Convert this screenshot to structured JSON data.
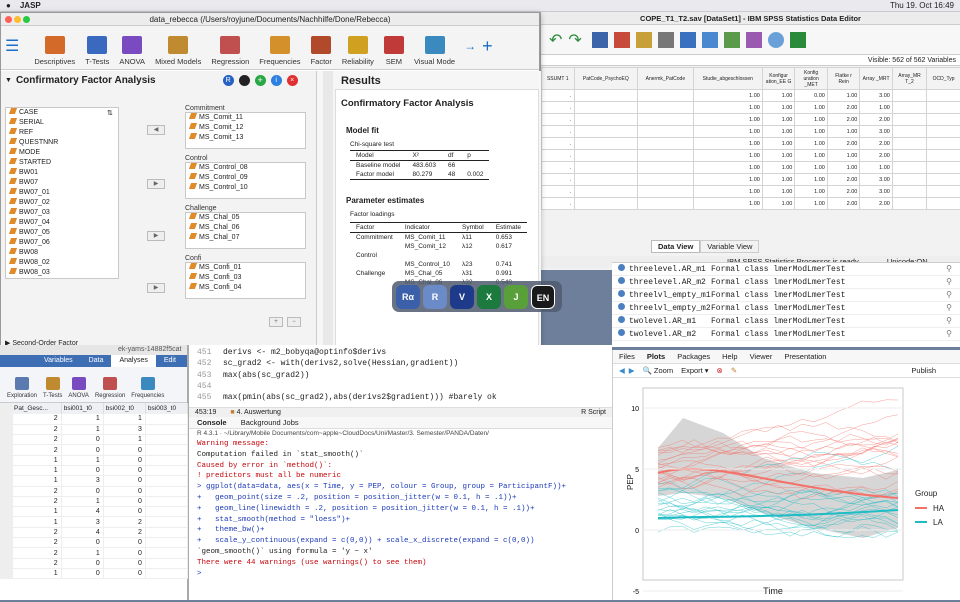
{
  "menubar": {
    "app": "JASP",
    "time": "Thu 19. Oct  16:49"
  },
  "jasp": {
    "title": "data_rebecca     (/Users/royjune/Documents/Nachhilfe/Done/Rebecca)",
    "ribbon": [
      "Descriptives",
      "T-Tests",
      "ANOVA",
      "Mixed Models",
      "Regression",
      "Frequencies",
      "Factor",
      "Reliability",
      "SEM",
      "Visual Mode"
    ],
    "analysis_title": "Confirmatory Factor Analysis",
    "variables": [
      "CASE",
      "SERIAL",
      "REF",
      "QUESTNNR",
      "MODE",
      "STARTED",
      "BW01",
      "BW07",
      "BW07_01",
      "BW07_02",
      "BW07_03",
      "BW07_04",
      "BW07_05",
      "BW07_06",
      "BW08",
      "BW08_02",
      "BW08_03"
    ],
    "factors": [
      {
        "name": "Commitment",
        "items": [
          "MS_Comit_11",
          "MS_Comit_12",
          "MS_Comit_13"
        ]
      },
      {
        "name": "Control",
        "items": [
          "MS_Control_08",
          "MS_Control_09",
          "MS_Control_10"
        ]
      },
      {
        "name": "Challenge",
        "items": [
          "MS_Chal_05",
          "MS_Chal_06",
          "MS_Chal_07"
        ]
      },
      {
        "name": "Confi",
        "items": [
          "MS_Confi_01",
          "MS_Confi_03",
          "MS_Confi_04"
        ]
      }
    ],
    "second_order": "Second-Order Factor",
    "results": {
      "heading": "Results",
      "cfa": "Confirmatory Factor Analysis",
      "model_fit": "Model fit",
      "chi_square": "Chi-square test",
      "fit_cols": [
        "Model",
        "X²",
        "df",
        "p"
      ],
      "fit_rows": [
        [
          "Baseline model",
          "483.603",
          "66",
          ""
        ],
        [
          "Factor model",
          "80.279",
          "48",
          "0.002"
        ]
      ],
      "param": "Parameter estimates",
      "loadings": "Factor loadings",
      "load_cols": [
        "Factor",
        "Indicator",
        "Symbol",
        "Estimate"
      ],
      "load_rows": [
        [
          "Commitment",
          "MS_Comit_11",
          "λ11",
          "0.653"
        ],
        [
          "",
          "MS_Comit_12",
          "λ12",
          "0.617"
        ],
        [
          "Control",
          "",
          "",
          ""
        ],
        [
          "",
          "MS_Control_10",
          "λ23",
          "0.741"
        ],
        [
          "Challenge",
          "MS_Chal_05",
          "λ31",
          "0.991"
        ],
        [
          "",
          "MS_Chal_06",
          "λ32",
          "0.540"
        ]
      ]
    }
  },
  "spss": {
    "title": "COPE_T1_T2.sav [DataSet1] - IBM SPSS Statistics Data Editor",
    "visible": "Visible: 562 of 562 Variables",
    "cols": [
      "SSUMT 1",
      "PatCode_PsychoEQ",
      "Anermk_PatCode",
      "Studie_abgeschlossen",
      "Konfigur ation_EE G",
      "Konfig uration _MET",
      "Flatke r Rein",
      "Array _MRT",
      "Array_MR T_2",
      "OCD_Typ"
    ],
    "rows": [
      [
        ".",
        "",
        "",
        "1.00",
        "1.00",
        "0.00",
        "1.00",
        "3.00",
        "",
        ""
      ],
      [
        ".",
        "",
        "",
        "1.00",
        "1.00",
        "1.00",
        "2.00",
        "1.00",
        "",
        ""
      ],
      [
        ".",
        "",
        "",
        "1.00",
        "1.00",
        "1.00",
        "2.00",
        "2.00",
        "",
        ""
      ],
      [
        ".",
        "",
        "",
        "1.00",
        "1.00",
        "1.00",
        "1.00",
        "3.00",
        "",
        ""
      ],
      [
        ".",
        "",
        "",
        "1.00",
        "1.00",
        "1.00",
        "2.00",
        "2.00",
        "",
        ""
      ],
      [
        ".",
        "",
        "",
        "1.00",
        "1.00",
        "1.00",
        "1.00",
        "2.00",
        "",
        ""
      ],
      [
        ".",
        "",
        "",
        "1.00",
        "1.00",
        "1.00",
        "1.00",
        "1.00",
        "",
        ""
      ],
      [
        ".",
        "",
        "",
        "1.00",
        "1.00",
        "1.00",
        "2.00",
        "3.00",
        "",
        ""
      ],
      [
        ".",
        "",
        "",
        "1.00",
        "1.00",
        "1.00",
        "2.00",
        "3.00",
        "",
        ""
      ],
      [
        ".",
        "",
        "",
        "1.00",
        "1.00",
        "1.00",
        "2.00",
        "2.00",
        "",
        ""
      ]
    ],
    "tabs": [
      "Data View",
      "Variable View"
    ],
    "status": "IBM SPSS Statistics Processor is ready",
    "unicode": "Unicode:ON"
  },
  "env": [
    [
      "threelevel.AR_m1",
      "Formal class  lmerModLmerTest"
    ],
    [
      "threelevel.AR_m2",
      "Formal class  lmerModLmerTest"
    ],
    [
      "threelvl_empty_m1",
      "Formal class  lmerModLmerTest"
    ],
    [
      "threelvl_empty_m2",
      "Formal class  lmerModLmerTest"
    ],
    [
      "twolevel.AR_m1",
      "Formal class  lmerModLmerTest"
    ],
    [
      "twolevel.AR_m2",
      "Formal class  lmerModLmerTest"
    ]
  ],
  "plots": {
    "tabs": [
      "Files",
      "Plots",
      "Packages",
      "Help",
      "Viewer",
      "Presentation"
    ],
    "zoom": "Zoom",
    "export": "Export",
    "publish": "Publish",
    "legend_title": "Group",
    "legend": [
      "HA",
      "LA"
    ],
    "ylabel": "PEP",
    "xlabel": "Time",
    "yticks": [
      "10",
      "5",
      "0",
      "-5"
    ]
  },
  "rstudio": {
    "code": [
      {
        "n": "451",
        "t": "derivs <- m2_bobyqa@optinfo$derivs"
      },
      {
        "n": "452",
        "t": "sc_grad2 <- with(derivs2,solve(Hessian,gradient))"
      },
      {
        "n": "453",
        "t": "max(abs(sc_grad2))"
      },
      {
        "n": "454",
        "t": ""
      },
      {
        "n": "455",
        "t": "max(pmin(abs(sc_grad2),abs(derivs2$gradient))) #barely ok"
      }
    ],
    "pos": "453:19",
    "section": "4. Auswertung",
    "lang": "R Script",
    "tabs": [
      "Console",
      "Background Jobs"
    ],
    "path": "R 4.3.1 · ~/Library/Mobile Documents/com~apple~CloudDocs/Uni/Master/3. Semester/PANDA/Daten/",
    "console": [
      {
        "c": "red",
        "t": "Warning message:"
      },
      {
        "c": "",
        "t": "Computation failed in `stat_smooth()`"
      },
      {
        "c": "red",
        "t": "Caused by error in `method()`:"
      },
      {
        "c": "red",
        "t": "! predictors must all be numeric"
      },
      {
        "c": "blue",
        "t": "> ggplot(data=data, aes(x = Time, y = PEP, colour = Group, group = ParticipantF))+"
      },
      {
        "c": "blue",
        "t": "+   geom_point(size = .2, position = position_jitter(w = 0.1, h = .1))+"
      },
      {
        "c": "blue",
        "t": "+   geom_line(linewidth = .2, position = position_jitter(w = 0.1, h = .1))+"
      },
      {
        "c": "blue",
        "t": "+   stat_smooth(method = \"loess\")+"
      },
      {
        "c": "blue",
        "t": "+   theme_bw()+"
      },
      {
        "c": "blue",
        "t": "+   scale_y_continuous(expand = c(0,0)) + scale_x_discrete(expand = c(0,0))"
      },
      {
        "c": "",
        "t": "`geom_smooth()` using formula = 'y ~ x'"
      },
      {
        "c": "red",
        "t": "There were 44 warnings (use warnings() to see them)"
      },
      {
        "c": "blue",
        "t": ">"
      }
    ]
  },
  "jamovi": {
    "title": "ek-yams-14882f5cat",
    "tabs": [
      "Variables",
      "Data",
      "Analyses",
      "Edit"
    ],
    "tools": [
      "Exploration",
      "T-Tests",
      "ANOVA",
      "Regression",
      "Frequencies"
    ],
    "cols": [
      "Pat_Gesc...",
      "bsi001_t0",
      "bsi002_t0",
      "bsi003_t0"
    ],
    "rows": [
      [
        "2",
        "1",
        "1"
      ],
      [
        "2",
        "1",
        "3"
      ],
      [
        "2",
        "0",
        "1"
      ],
      [
        "2",
        "0",
        "0"
      ],
      [
        "1",
        "1",
        "0"
      ],
      [
        "1",
        "0",
        "0"
      ],
      [
        "1",
        "3",
        "0"
      ],
      [
        "2",
        "0",
        "0"
      ],
      [
        "2",
        "1",
        "0"
      ],
      [
        "1",
        "4",
        "0"
      ],
      [
        "1",
        "3",
        "2"
      ],
      [
        "2",
        "4",
        "2"
      ],
      [
        "2",
        "0",
        "0"
      ],
      [
        "2",
        "1",
        "0"
      ],
      [
        "2",
        "0",
        "0"
      ],
      [
        "1",
        "0",
        "0"
      ]
    ]
  },
  "dock": [
    "Rα",
    "R",
    "V",
    "X",
    "J",
    "EN"
  ]
}
